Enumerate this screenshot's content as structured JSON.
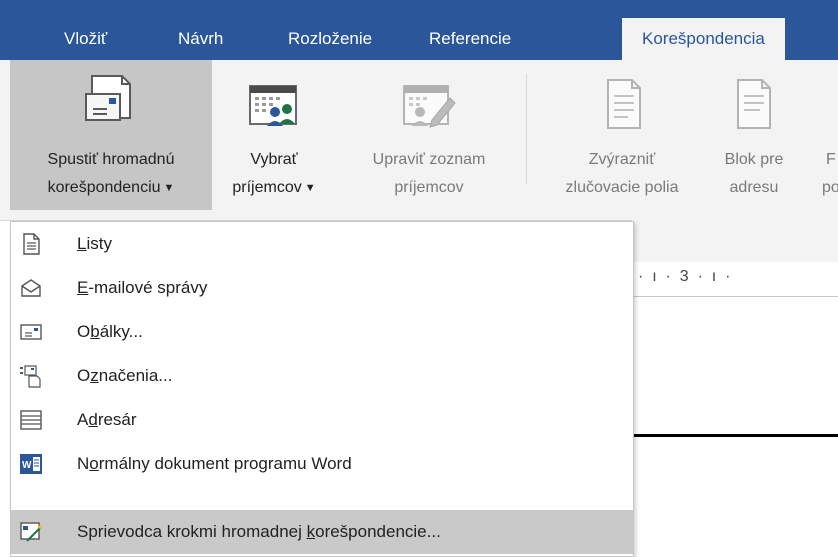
{
  "tabs": [
    {
      "label": "Vložiť"
    },
    {
      "label": "Návrh"
    },
    {
      "label": "Rozloženie"
    },
    {
      "label": "Referencie"
    },
    {
      "label": "Korešpondencia"
    }
  ],
  "ribbon": {
    "start_mail_merge": {
      "line1": "Spustiť hromadnú",
      "line2": "korešpondenciu"
    },
    "select_recipients": {
      "line1": "Vybrať",
      "line2": "príjemcov"
    },
    "edit_recipient_list": {
      "line1": "Upraviť zoznam",
      "line2": "príjemcov"
    },
    "highlight_merge_fields": {
      "line1": "Zvýrazniť",
      "line2": "zlučovacie polia"
    },
    "address_block": {
      "line1": "Blok pre",
      "line2": "adresu"
    },
    "greeting_partial": {
      "line1": "F",
      "line2": "po"
    }
  },
  "ruler": {
    "text": "·  ı  ·  3  ·  ı  ·"
  },
  "menu": {
    "items": [
      {
        "pre": "",
        "key": "L",
        "post": "isty",
        "icon": "letters-icon"
      },
      {
        "pre": "",
        "key": "E",
        "post": "-mailové správy",
        "icon": "email-icon"
      },
      {
        "pre": "O",
        "key": "b",
        "post": "álky...",
        "icon": "envelope-icon"
      },
      {
        "pre": "O",
        "key": "z",
        "post": "načenia...",
        "icon": "labels-icon"
      },
      {
        "pre": "A",
        "key": "d",
        "post": "resár",
        "icon": "directory-icon"
      },
      {
        "pre": "N",
        "key": "o",
        "post": "rmálny dokument programu Word",
        "icon": "word-icon"
      },
      {
        "pre": "Sprievodca krokmi hromadnej ",
        "key": "k",
        "post": "orešpondencie...",
        "icon": "wizard-icon"
      }
    ]
  },
  "colors": {
    "accent": "#2b579a",
    "ribbon_bg": "#f3f3f3",
    "pressed": "#c6c6c6",
    "hover": "#c9c9c9"
  }
}
